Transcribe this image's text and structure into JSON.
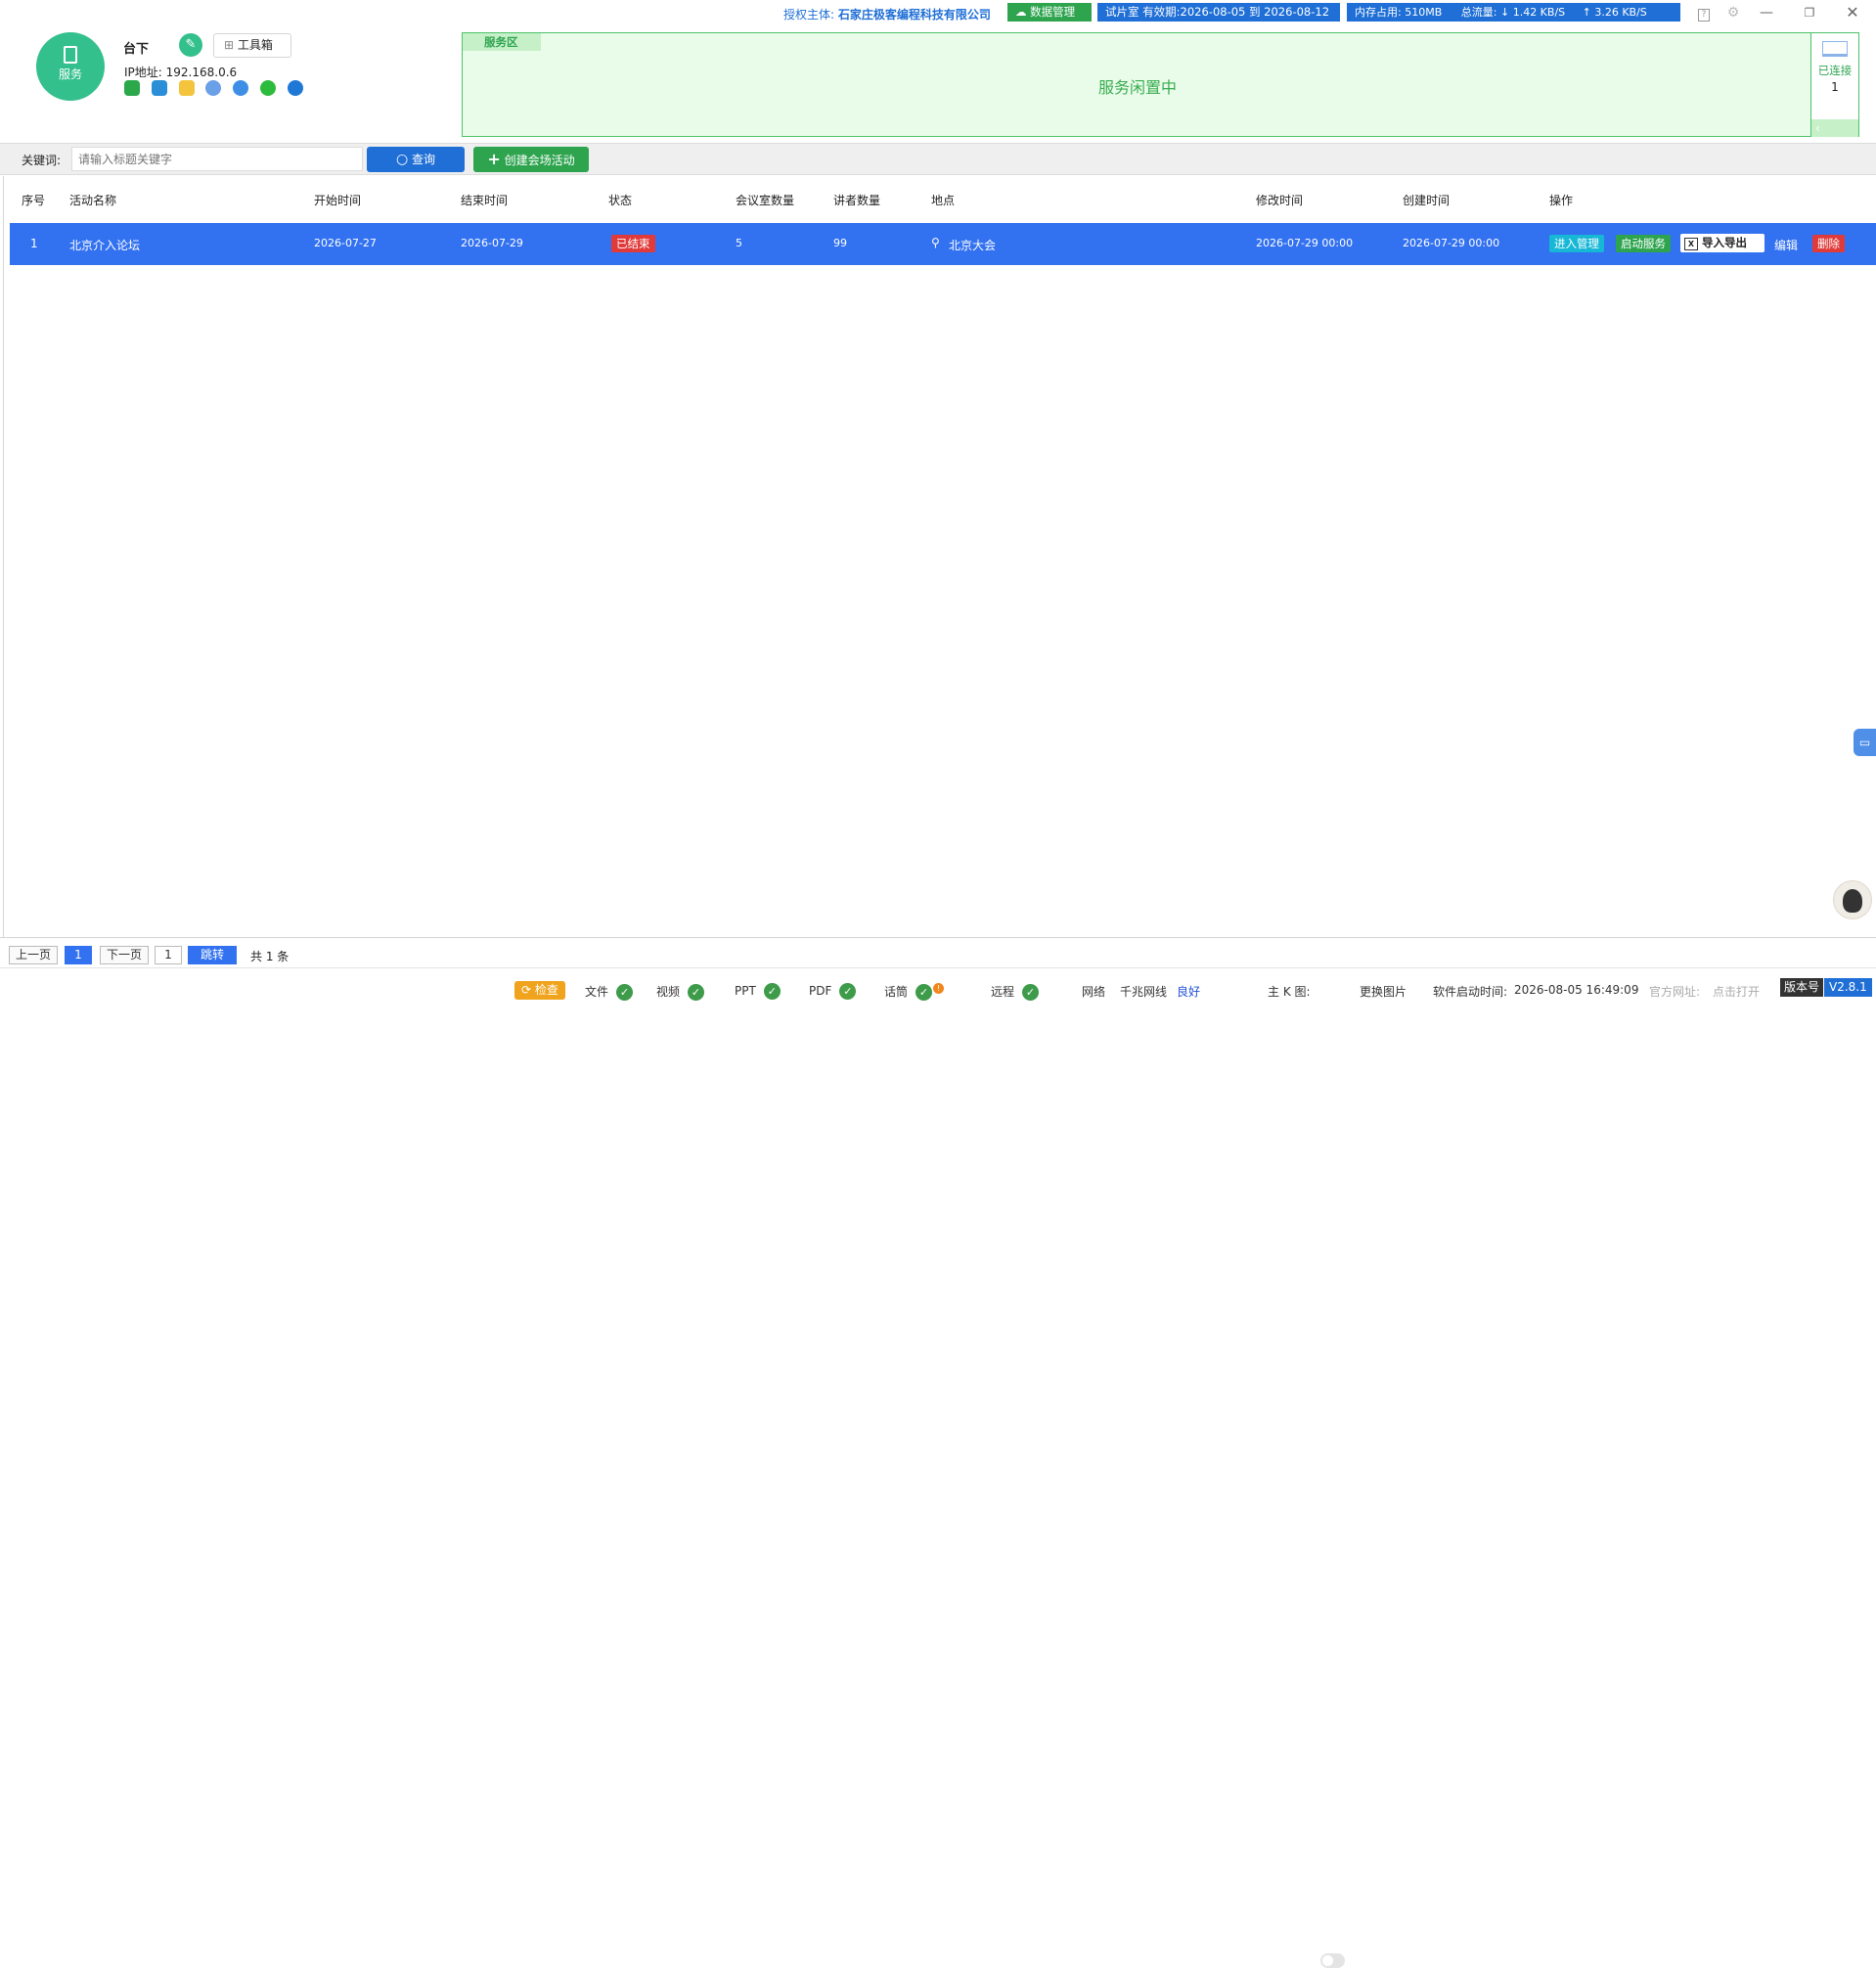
{
  "topbar": {
    "license_prefix": "授权主体:",
    "license_company": "石家庄极客编程科技有限公司",
    "data_manage_label": "数据管理",
    "trial_label": "试片室 有效期:2026-08-05 到 2026-08-12",
    "memory_label": "内存占用:",
    "memory_value": "510MB",
    "traffic_label": "总流量:",
    "download_value": "↓ 1.42 KB/S",
    "upload_value": "↑ 3.26 KB/S"
  },
  "profile": {
    "avatar_label": "服务",
    "name": "台下",
    "toolbox_label": "工具箱",
    "ip_label": "IP地址: 192.168.0.6"
  },
  "service_area": {
    "tab_label": "服务区",
    "message": "服务闲置中",
    "connected_label": "已连接",
    "connected_count": "1"
  },
  "search": {
    "keyword_label": "关键词:",
    "placeholder": "请输入标题关键字",
    "query_label": "查询",
    "create_label": "创建会场活动"
  },
  "table": {
    "columns": [
      "序号",
      "活动名称",
      "开始时间",
      "结束时间",
      "状态",
      "会议室数量",
      "讲者数量",
      "地点",
      "修改时间",
      "创建时间",
      "操作"
    ],
    "rows": [
      {
        "index": "1",
        "name": "北京介入论坛",
        "start": "2026-07-27",
        "end": "2026-07-29",
        "status": "已结束",
        "rooms": "5",
        "speakers": "99",
        "location": "北京大会",
        "modified": "2026-07-29 00:00",
        "created": "2026-07-29 00:00",
        "actions": {
          "enter": "进入管理",
          "start": "启动服务",
          "import_export": "导入导出",
          "edit": "编辑",
          "delete": "删除"
        }
      }
    ]
  },
  "pager": {
    "prev": "上一页",
    "current": "1",
    "next": "下一页",
    "jump_value": "1",
    "jump_label": "跳转",
    "total": "共 1 条"
  },
  "status": {
    "check_label": "检查",
    "file": "文件",
    "video": "视频",
    "ppt": "PPT",
    "pdf": "PDF",
    "mic": "话筒",
    "remote": "远程",
    "network_label": "网络",
    "network_type": "千兆网线",
    "network_quality": "良好",
    "main_k_label": "主 K 图:",
    "change_image": "更换图片",
    "startup_label": "软件启动时间:",
    "startup_time": "2026-08-05 16:49:09",
    "official_site": "官方网址:",
    "click_open": "点击打开",
    "version_label": "版本号",
    "version_value": "V2.8.1"
  },
  "colors": {
    "primary_blue": "#3271f0",
    "green": "#33c08d",
    "service_green": "#4cc36a",
    "danger_red": "#e03a3a"
  }
}
